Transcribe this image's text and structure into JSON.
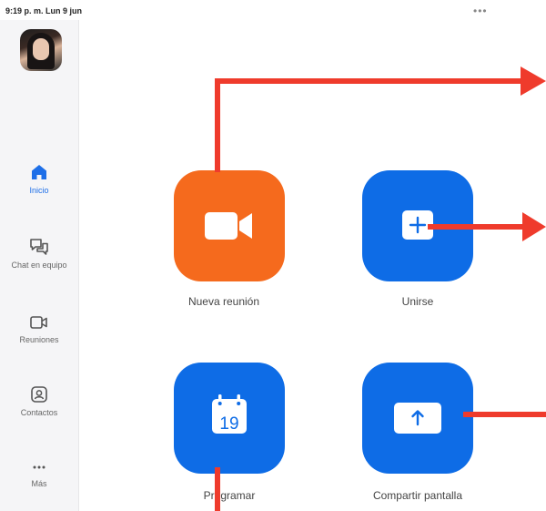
{
  "status_bar": {
    "time": "9:19 p. m.  Lun 9 jun",
    "more": "•••"
  },
  "sidebar": {
    "items": [
      {
        "label": "Inicio",
        "icon": "home-icon",
        "active": true
      },
      {
        "label": "Chat en equipo",
        "icon": "chat-icon",
        "active": false
      },
      {
        "label": "Reuniones",
        "icon": "video-camera-icon",
        "active": false
      },
      {
        "label": "Contactos",
        "icon": "contact-icon",
        "active": false
      },
      {
        "label": "Más",
        "icon": "more-icon",
        "active": false
      }
    ]
  },
  "actions": [
    {
      "label": "Nueva reunión",
      "icon": "video-camera-icon",
      "color": "#f56a1d"
    },
    {
      "label": "Unirse",
      "icon": "plus-icon",
      "color": "#0e6ce6"
    },
    {
      "label": "Programar",
      "icon": "calendar-icon",
      "color": "#0e6ce6",
      "calendar_day": "19"
    },
    {
      "label": "Compartir pantalla",
      "icon": "share-screen-icon",
      "color": "#0e6ce6"
    }
  ],
  "colors": {
    "accent": "#1e6fe8",
    "annotation_arrow": "#ef3b2c"
  }
}
